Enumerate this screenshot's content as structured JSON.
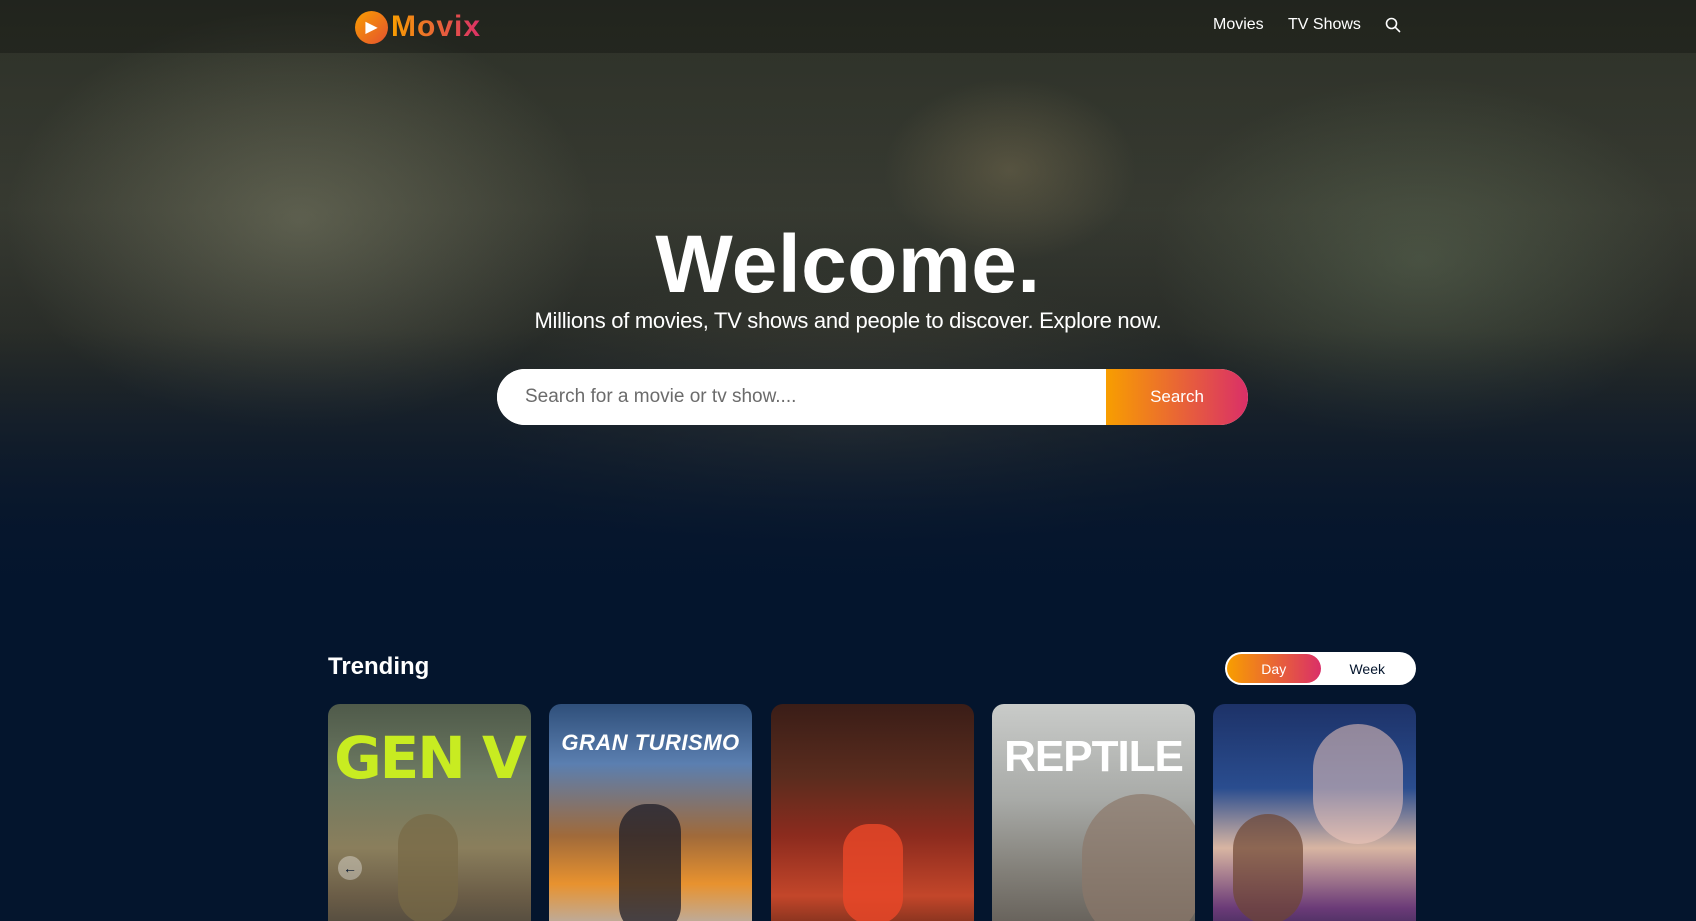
{
  "header": {
    "logo_text": "Movix",
    "nav": {
      "movies": "Movies",
      "tv_shows": "TV Shows"
    },
    "search_icon": "search-icon"
  },
  "hero": {
    "title": "Welcome.",
    "subtitle": "Millions of movies, TV shows and people to discover. Explore now.",
    "search_placeholder": "Search for a movie or tv show....",
    "search_button": "Search"
  },
  "trending": {
    "title": "Trending",
    "tabs": [
      "Day",
      "Week"
    ],
    "active_tab": "Day",
    "posters": [
      {
        "title_text": "GEN V"
      },
      {
        "title_text": "GRAN TURISMO"
      },
      {
        "title_text": ""
      },
      {
        "title_text": "REPTILE"
      },
      {
        "title_text": ""
      }
    ],
    "carousel_prev_icon": "arrow-left-icon"
  },
  "colors": {
    "background": "#04152d",
    "accent_start": "#f89e00",
    "accent_end": "#da2f68"
  }
}
